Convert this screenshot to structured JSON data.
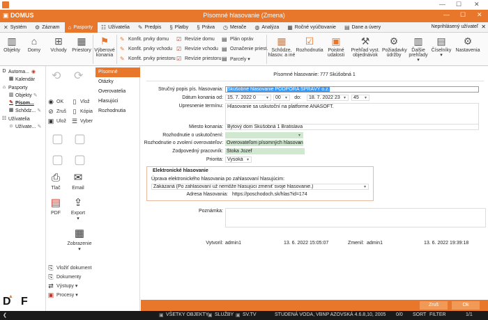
{
  "window": {
    "app": "DOMUS",
    "title": "Písomné hlasovanie (Zmena)"
  },
  "menu": {
    "items": [
      {
        "label": "Systém",
        "icon": "✕"
      },
      {
        "label": "Záznam",
        "icon": "⚙"
      },
      {
        "label": "Pasporty",
        "icon": "⌂"
      },
      {
        "label": "Užívatelia",
        "icon": "☷"
      },
      {
        "label": "Predpis",
        "icon": "✎"
      },
      {
        "label": "Platby",
        "icon": "§"
      },
      {
        "label": "Práva",
        "icon": "§"
      },
      {
        "label": "Merače",
        "icon": "◷"
      },
      {
        "label": "Analýza",
        "icon": "◍"
      },
      {
        "label": "Ročné vyúčtovanie",
        "icon": "▦"
      },
      {
        "label": "Dane a úvery",
        "icon": "▤"
      }
    ],
    "user": "Neprihlásený užívateľ"
  },
  "ribbon": {
    "objekty": "Objekty",
    "domy": "Domy",
    "vchody": "Vchody",
    "priestory": "Priestory",
    "vyberove1": "Výberové",
    "vyberove2": "konania",
    "konf_domu": "Konfit. prvky domu",
    "konf_vchodu": "Konfit. prvky vchodu",
    "konf_priestoru": "Konfit. prvky priestoru",
    "rev_domu": "Revízie domu",
    "rev_vchodu": "Revízie vchodu",
    "rev_priestoru": "Revízie priestoru",
    "plan": "Plán opráv",
    "oznacenie": "Označenie priest.",
    "parcely": "Parcely ▾",
    "schodze1": "Schôdze,",
    "schodze2": "hlasov. a iné",
    "rozhodnutia": "Rozhodnutia",
    "poistne1": "Poistné",
    "poistne2": "udalosti",
    "prehlad1": "Prehľad vyst.",
    "prehlad2": "objednávok",
    "poziadavky1": "Požiadavky",
    "poziadavky2": "údržby",
    "dalsie1": "Ďalšie",
    "dalsie2": "prehľady ▾",
    "ciselniky1": "Číselníky",
    "ciselniky2": "▾",
    "nastavenia": "Nastavenia"
  },
  "tree": {
    "root": "Automa...",
    "kalendar": "Kalendár",
    "pasporty": "Pasporty",
    "objekty": "Objekty",
    "pisom": "Písom...",
    "schodz": "Schôdz...",
    "uzivatelia": "Užívatelia",
    "uzivate": "Užívate..."
  },
  "actions": {
    "ok": "OK",
    "vloz": "Vlož",
    "zrus": "Zruš",
    "kopia": "Kópia",
    "uloz": "Ulož",
    "vyber": "Vyber",
    "tlac": "Tlač",
    "email": "Email",
    "pdf": "PDF",
    "export": "Export",
    "export_arrow": "▾",
    "zobrazenie": "Zobrazenie",
    "zobrazenie_arrow": "▾",
    "vlozit_dokument": "Vložiť dokument",
    "dokumenty": "Dokumenty",
    "vystupy": "Výstupy ▾",
    "procesy": "Procesy ▾"
  },
  "tabs": [
    "Písomné hlasovanie",
    "Otázky",
    "Overovatelia",
    "Hlasujúci",
    "Rozhodnutia"
  ],
  "form": {
    "header": "Písomné hlasovanie: 777 Skúšobná 1",
    "strucny_lbl": "Stručný popis pís. hlasovania:",
    "strucny_val": "Skúšobné hlasovanie PODPORA SPRÁVY o.z.",
    "datum_lbl": "Dátum konania od:",
    "datum_od": "15. 7. 2022 0",
    "cas_od": "00",
    "do_lbl": "do:",
    "datum_do": "18. 7. 2022 23",
    "cas_do": "45",
    "upresnenie_lbl": "Upresnenie termínu:",
    "upresnenie_val": "Hlasovanie sa uskutoční na platforme ANASOFT.",
    "miesto_lbl": "Miesto konania:",
    "miesto_val": "Bytový dom Skúšobná 1 Bratislava",
    "rozh_usk_lbl": "Rozhodnutie o uskutočnení:",
    "rozh_zvol_lbl": "Rozhodnutie o zvolení overovateľov:",
    "rozh_zvol_val": "Overovateľom písomných hlasovaní",
    "zodp_lbl": "Zodpovedný pracovník:",
    "zodp_val": "Štoka Jozef",
    "priorita_lbl": "Priorita:",
    "priorita_val": "Vysoká",
    "el_title": "Elektronické hlasovanie",
    "uprava_lbl": "Úprava elektronického hlasovania po zahlasovaní hlasujúcim:",
    "uprava_val": "Zakázaná (Po zahlasovaní už nemôže hlasujúci zmeniť svoje hlasovanie.)",
    "adresa_lbl": "Adresa hlasovania:",
    "adresa_val": "https://poschodoch.sk/hlas?id=174",
    "poznamka_lbl": "Poznámka:",
    "vytvoril_lbl": "Vytvoril:",
    "vytvoril_val": "admin1",
    "vytvoril_date": "13. 6. 2022 15:05:07",
    "zmenil_lbl": "Zmenil:",
    "zmenil_val": "admin1",
    "zmenil_date": "13. 6. 2022 19:39:18"
  },
  "buttons": {
    "zrus": "Zruš",
    "ok": "Ok"
  },
  "status": {
    "vsetky": "VŠETKY OBJEKTY",
    "sluzby": "SLUŽBY",
    "sv": "SV.TV",
    "info": "STUDENÁ VODA, VBNP AZOVSKÁ 4.6.8,10, 2005",
    "counter": "0/0",
    "sort": "SORT",
    "filter": "FILTER",
    "page": "1/1"
  },
  "colors": {
    "accent": "#e8762b",
    "selection": "#3399ff",
    "field_green": "#cfe8cf"
  }
}
